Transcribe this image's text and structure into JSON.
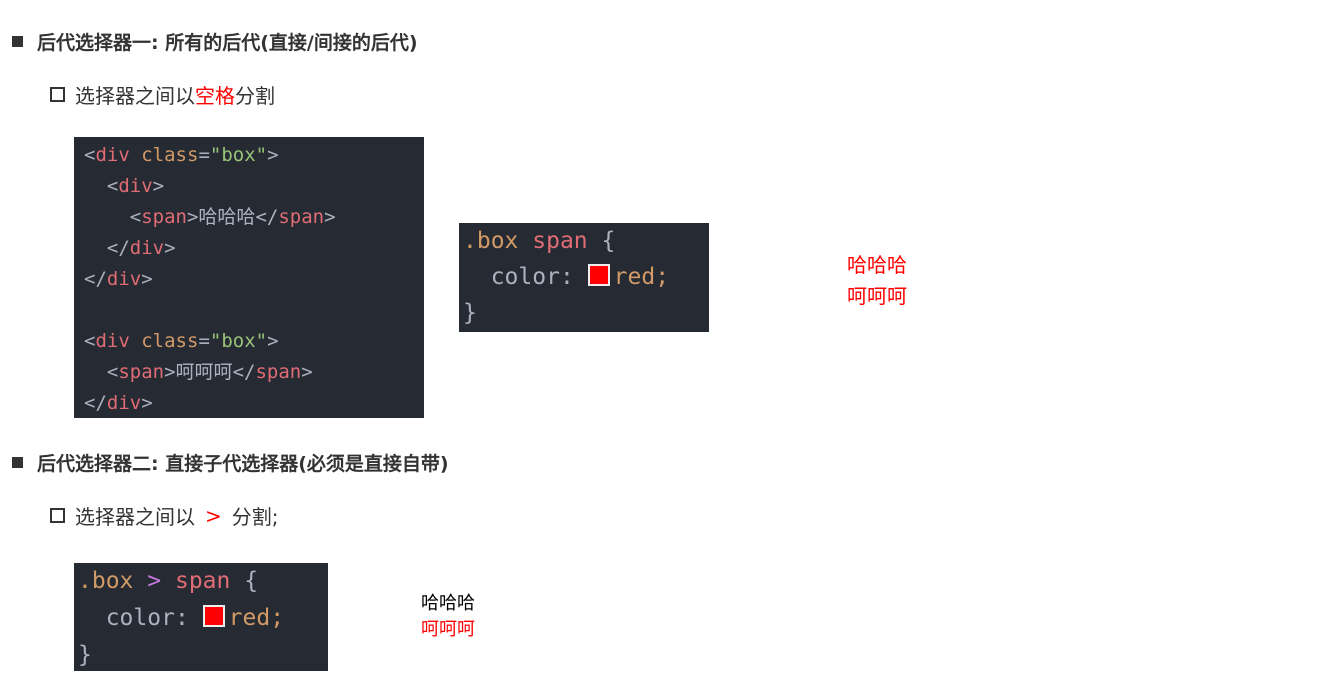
{
  "section1": {
    "title": "后代选择器一: 所有的后代(直接/间接的后代)",
    "sub_prefix": "选择器之间以",
    "sub_highlight": "空格",
    "sub_suffix": "分割"
  },
  "html_code": {
    "lines": [
      [
        "<",
        "div",
        " class",
        "=",
        "\"box\"",
        ">"
      ],
      [
        "<div>"
      ],
      [
        "<span>哈哈哈</span>"
      ],
      [
        "</div>"
      ],
      [
        "</div>"
      ],
      [
        "<div class=\"box\">"
      ],
      [
        "<span>呵呵呵</span>"
      ],
      [
        "</div>"
      ]
    ],
    "div": "div",
    "span": "span",
    "class": "class",
    "box": "\"box\"",
    "text1": "哈哈哈",
    "text2": "呵呵呵"
  },
  "css1": {
    "selector_class": ".box",
    "selector_el": "span",
    "open": "{",
    "prop": "color:",
    "value": "red;",
    "close": "}"
  },
  "result1": [
    "哈哈哈",
    "呵呵呵"
  ],
  "section2": {
    "title": "后代选择器二: 直接子代选择器(必须是直接自带)",
    "sub_prefix": "选择器之间以",
    "sub_highlight": ">",
    "sub_suffix": "分割;"
  },
  "css2": {
    "selector_class": ".box",
    "combinator": ">",
    "selector_el": "span",
    "open": "{",
    "prop": "color:",
    "value": "red;",
    "close": "}"
  },
  "result2": [
    "哈哈哈",
    "呵呵呵"
  ],
  "colors": {
    "highlight": "#ff0000",
    "code_bg": "#262a33"
  }
}
